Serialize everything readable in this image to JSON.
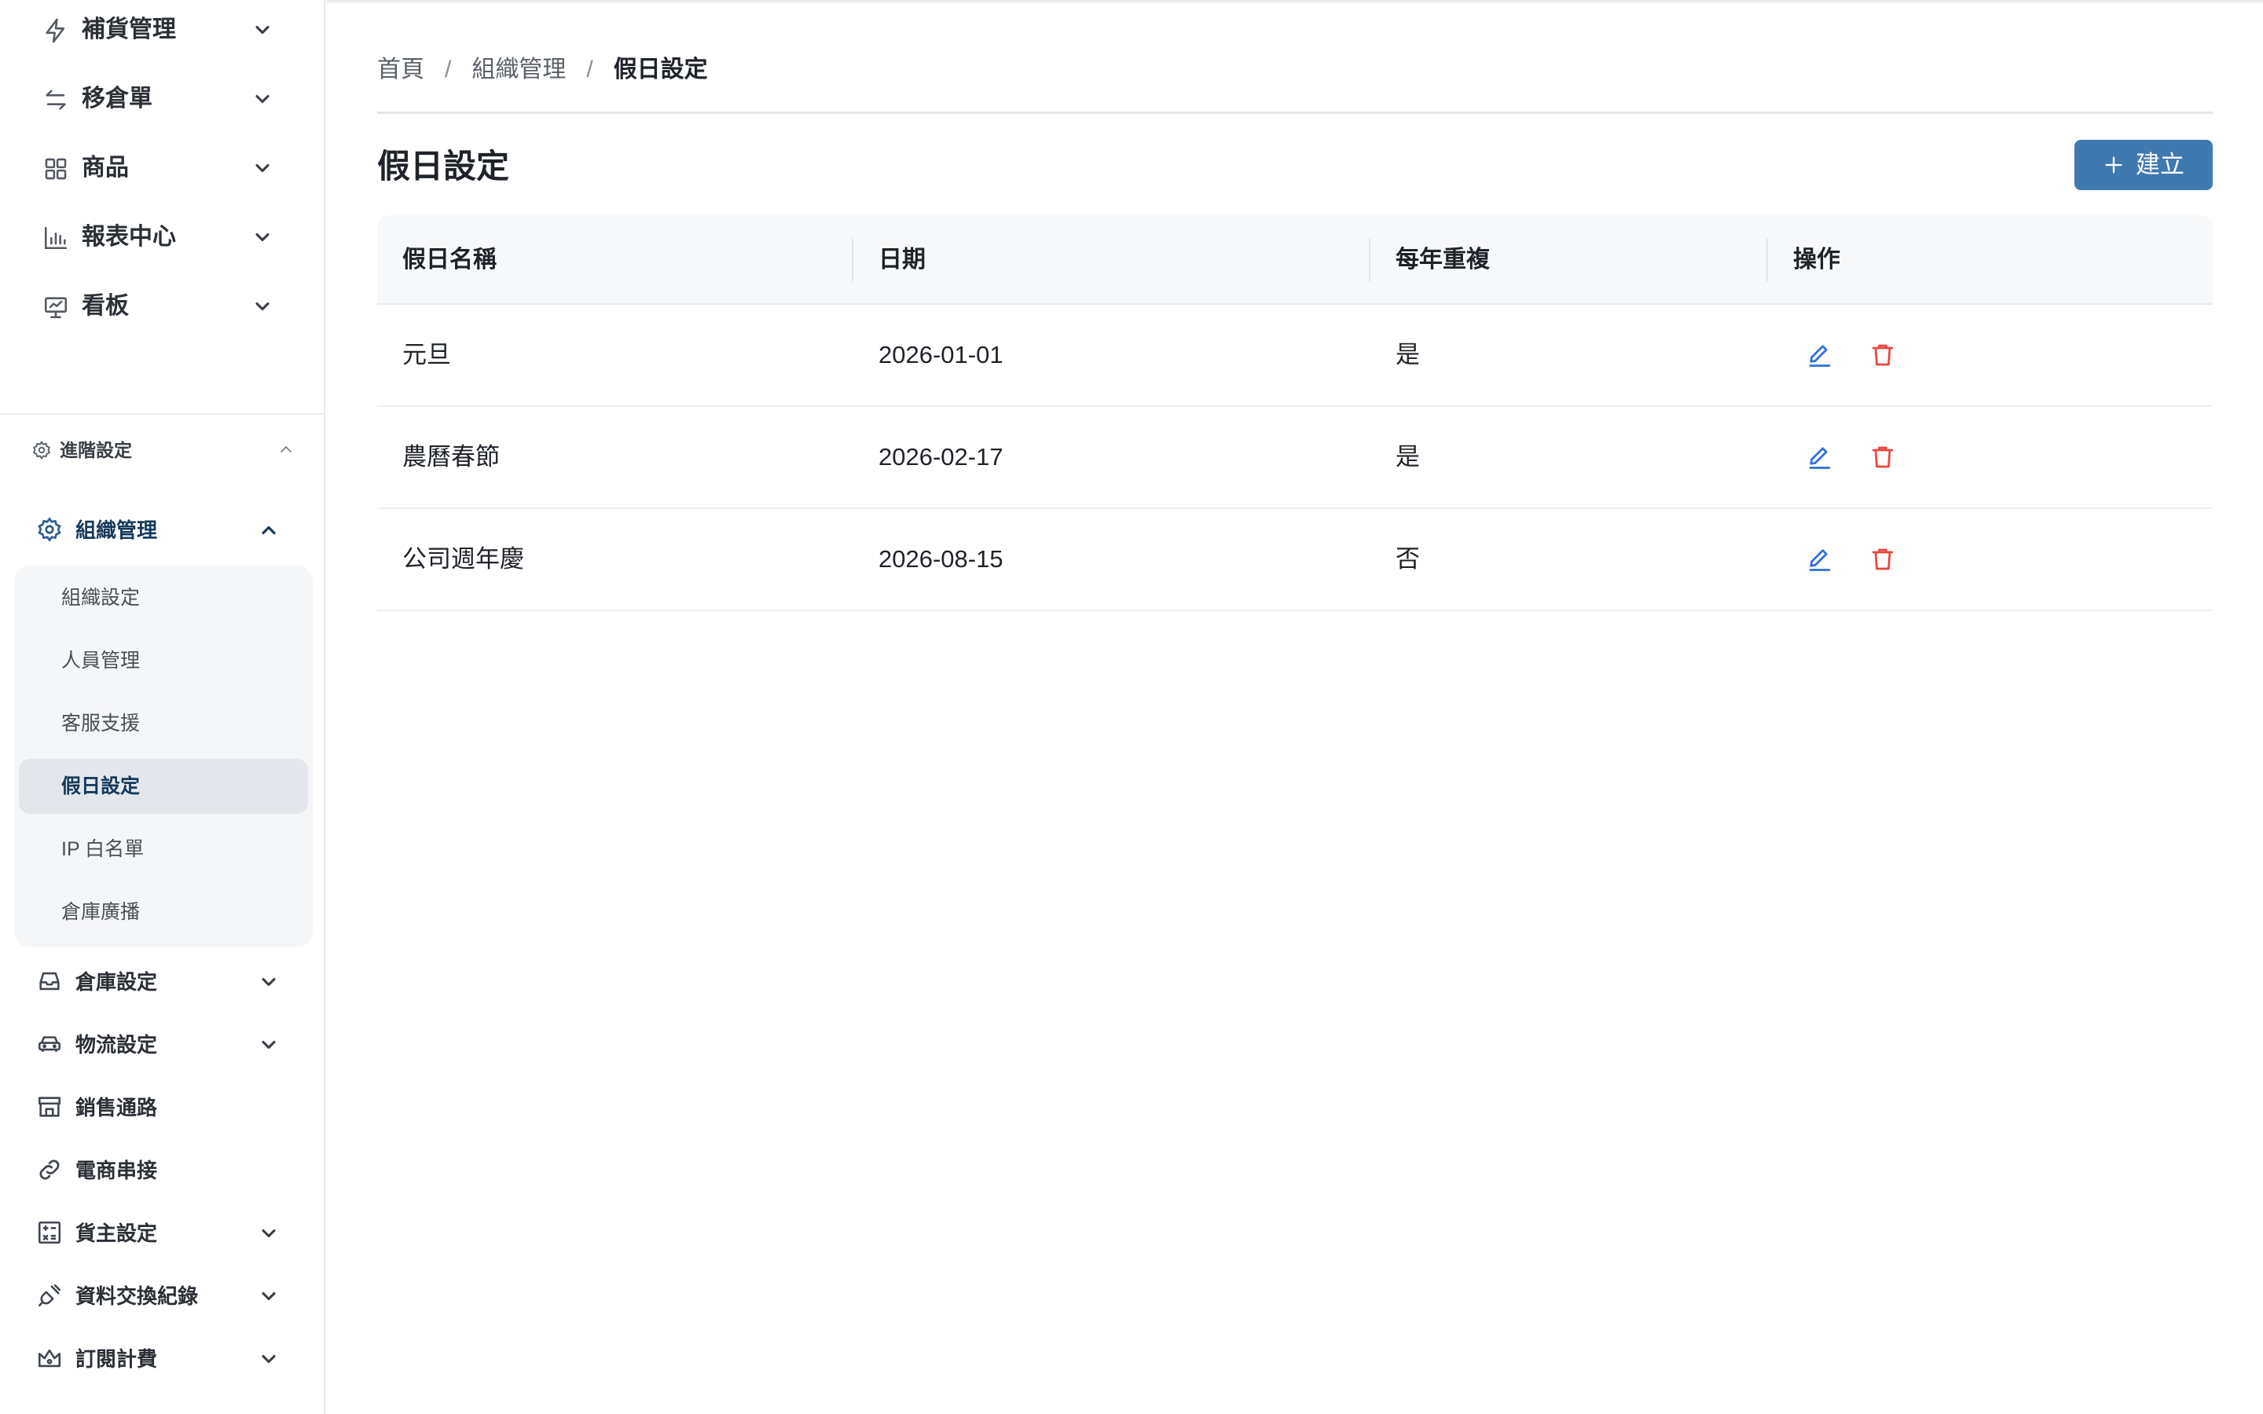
{
  "sidebar": {
    "top_items": [
      {
        "label": "補貨管理",
        "icon": "bolt-icon"
      },
      {
        "label": "移倉單",
        "icon": "transfer-icon"
      },
      {
        "label": "商品",
        "icon": "grid-icon"
      },
      {
        "label": "報表中心",
        "icon": "bar-chart-icon"
      },
      {
        "label": "看板",
        "icon": "presentation-icon"
      }
    ],
    "advanced": {
      "label": "進階設定",
      "icon": "gear-icon",
      "expanded": true
    },
    "org": {
      "label": "組織管理",
      "icon": "gear-icon",
      "children": [
        {
          "label": "組織設定"
        },
        {
          "label": "人員管理"
        },
        {
          "label": "客服支援"
        },
        {
          "label": "假日設定",
          "active": true
        },
        {
          "label": "IP 白名單"
        },
        {
          "label": "倉庫廣播"
        }
      ]
    },
    "lower_items": [
      {
        "label": "倉庫設定",
        "icon": "inbox-icon",
        "has_children": true
      },
      {
        "label": "物流設定",
        "icon": "car-icon",
        "has_children": true
      },
      {
        "label": "銷售通路",
        "icon": "store-icon",
        "has_children": false
      },
      {
        "label": "電商串接",
        "icon": "link-icon",
        "has_children": false
      },
      {
        "label": "貨主設定",
        "icon": "calculator-icon",
        "has_children": true
      },
      {
        "label": "資料交換紀錄",
        "icon": "plug-icon",
        "has_children": true
      },
      {
        "label": "訂閱計費",
        "icon": "crown-icon",
        "has_children": true
      }
    ]
  },
  "breadcrumb": {
    "items": [
      "首頁",
      "組織管理",
      "假日設定"
    ],
    "separator": "/"
  },
  "page": {
    "title": "假日設定",
    "create_label": "建立"
  },
  "table": {
    "columns": [
      "假日名稱",
      "日期",
      "每年重複",
      "操作"
    ],
    "rows": [
      {
        "name": "元旦",
        "date": "2026-01-01",
        "repeat": "是"
      },
      {
        "name": "農曆春節",
        "date": "2026-02-17",
        "repeat": "是"
      },
      {
        "name": "公司週年慶",
        "date": "2026-08-15",
        "repeat": "否"
      }
    ]
  },
  "colors": {
    "primary": "#3f79b0",
    "active_text": "#163a5c",
    "edit": "#2f6fd6",
    "delete": "#e8473f"
  }
}
